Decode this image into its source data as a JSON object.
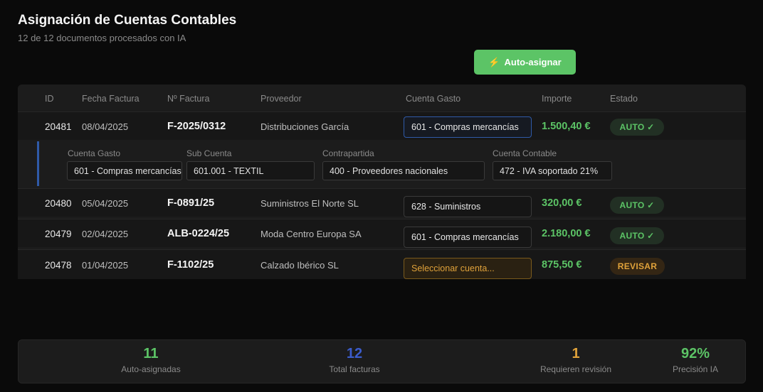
{
  "header": {
    "title": "Asignación de Cuentas Contables",
    "subtitle": "12 de 12 documentos procesados con IA"
  },
  "actions": {
    "auto_assign_label": "Auto-asignar",
    "auto_assign_icon": "bolt-icon",
    "accent": "#5cc466"
  },
  "table": {
    "columns": [
      "ID",
      "Fecha Factura",
      "Nº Factura",
      "Proveedor",
      "Cuenta Gasto",
      "Importe",
      "Estado"
    ],
    "rows": [
      {
        "id": "20481",
        "date": "08/04/2025",
        "invoice": "F-2025/0312",
        "supplier": "Distribuciones García",
        "account": "601 - Compras mercancías",
        "amount": "1.500,40 €",
        "status": "AUTO ✓"
      },
      {
        "id": "20480",
        "date": "05/04/2025",
        "invoice": "F-0891/25",
        "supplier": "Suministros El Norte SL",
        "account": "628 - Suministros",
        "amount": "320,00 €",
        "status": "AUTO ✓"
      },
      {
        "id": "20479",
        "date": "02/04/2025",
        "invoice": "ALB-0224/25",
        "supplier": "Moda Centro Europa SA",
        "account": "601 - Compras mercancías",
        "amount": "2.180,00 €",
        "status": "AUTO ✓"
      },
      {
        "id": "20478",
        "date": "01/04/2025",
        "invoice": "F-1102/25",
        "supplier": "Calzado Ibérico SL",
        "account": "Seleccionar cuenta...",
        "amount": "875,50 €",
        "status": "REVISAR"
      }
    ],
    "expanded": {
      "labels": [
        "Cuenta Gasto",
        "Sub Cuenta",
        "Contrapartida",
        "Cuenta Contable"
      ],
      "values": [
        "601 - Compras mercancías",
        "601.001 - TEXTIL",
        "400 - Proveedores nacionales",
        "472 - IVA soportado 21%"
      ]
    }
  },
  "stats": [
    {
      "value": "11",
      "label": "Auto-asignadas",
      "color": "#5cc466"
    },
    {
      "value": "12",
      "label": "Total facturas",
      "color": "#3b5ccc"
    },
    {
      "value": "1",
      "label": "Requieren revisión",
      "color": "#e0a23a"
    },
    {
      "value": "92%",
      "label": "Precisión IA",
      "color": "#5cc466"
    }
  ]
}
